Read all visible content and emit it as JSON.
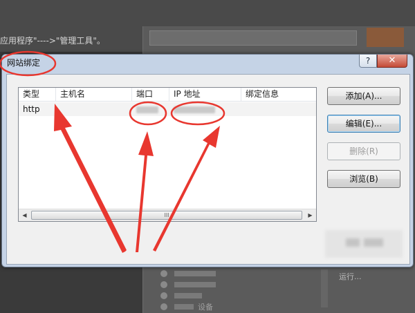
{
  "background": {
    "caption": "应用程序\"---->\"管理工具\"。",
    "list_item_text": "设备",
    "right_link": "运行..."
  },
  "dialog": {
    "title": "网站绑定",
    "help_label": "?",
    "close_label": "✕",
    "columns": [
      "类型",
      "主机名",
      "端口",
      "IP 地址",
      "绑定信息"
    ],
    "rows": [
      {
        "type": "http",
        "host": "",
        "port": "",
        "ip": "",
        "binding": ""
      }
    ],
    "scroll_grip": "III",
    "buttons": {
      "add": "添加(A)...",
      "edit": "编辑(E)...",
      "remove": "删除(R)",
      "browse": "浏览(B)"
    }
  },
  "colors": {
    "annotation": "#e8372f",
    "dialog_frame": "#c5d3e6",
    "close_button": "#c44a36"
  },
  "icons": [
    "help-icon",
    "close-icon",
    "scroll-left-icon",
    "scroll-right-icon"
  ]
}
